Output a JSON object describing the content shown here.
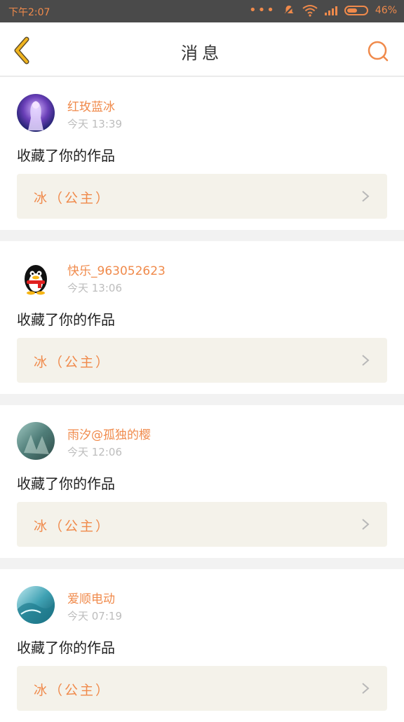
{
  "status_bar": {
    "time": "下午2:07",
    "battery": "46%",
    "icons": [
      "more-dots-icon",
      "mute-icon",
      "wifi-icon",
      "signal-icon",
      "battery-icon"
    ],
    "color": "#f08a4b"
  },
  "header": {
    "title": "消息",
    "back_icon": "back-chevron-icon",
    "search_icon": "search-icon"
  },
  "notifications": [
    {
      "user": "红玫蓝冰",
      "time": "今天 13:39",
      "action": "收藏了你的作品",
      "work": "冰（公主）"
    },
    {
      "user": "快乐_963052623",
      "time": "今天 13:06",
      "action": "收藏了你的作品",
      "work": "冰（公主）"
    },
    {
      "user": "雨汐@孤独的樱",
      "time": "今天 12:06",
      "action": "收藏了你的作品",
      "work": "冰（公主）"
    },
    {
      "user": "爱顺电动",
      "time": "今天 07:19",
      "action": "收藏了你的作品",
      "work": "冰（公主）"
    }
  ],
  "colors": {
    "accent": "#f08a4b",
    "work_bg": "#f4f2ea",
    "back_icon": "#f0b41e"
  }
}
